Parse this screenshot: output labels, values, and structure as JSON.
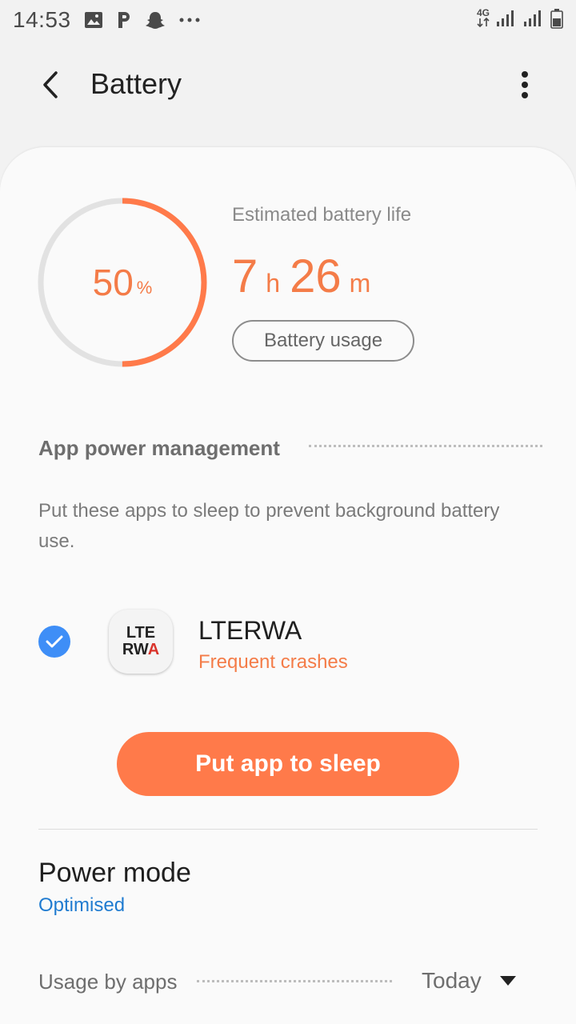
{
  "status_bar": {
    "time": "14:53",
    "left_icons": [
      "image-icon",
      "p-app-icon",
      "snapchat-icon",
      "more-notifications-icon"
    ],
    "network_label": "4G",
    "right_icons": [
      "signal-icon",
      "signal-icon",
      "battery-icon"
    ]
  },
  "app_bar": {
    "title": "Battery",
    "back_icon": "back-arrow-icon",
    "more_icon": "more-vertical-icon"
  },
  "battery": {
    "percent": "50",
    "percent_sign": "%",
    "level": 0.5,
    "estimate_label": "Estimated battery life",
    "hours": "7",
    "hours_unit": "h",
    "minutes": "26",
    "minutes_unit": "m",
    "usage_button": "Battery usage"
  },
  "power_management": {
    "title": "App power management",
    "description": "Put these apps to sleep to prevent background battery use.",
    "app": {
      "name": "LTERWA",
      "status": "Frequent crashes",
      "icon_line1": "LTE",
      "icon_line2": "RW",
      "icon_line2_accent": "A",
      "checked": true
    },
    "sleep_button": "Put app to sleep"
  },
  "power_mode": {
    "title": "Power mode",
    "value": "Optimised"
  },
  "usage_by_apps": {
    "title": "Usage by apps",
    "period": "Today"
  },
  "colors": {
    "accent": "#ff7a4a",
    "accent_text": "#f47c48",
    "link": "#1f7bd0",
    "check": "#3e8ef7"
  }
}
